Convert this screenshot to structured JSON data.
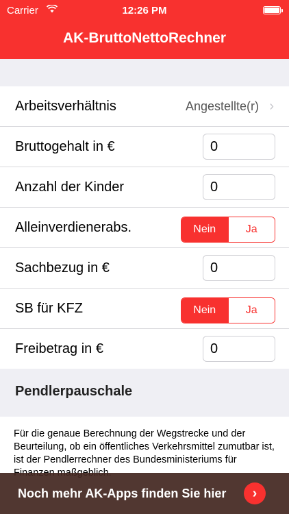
{
  "status_bar": {
    "carrier": "Carrier",
    "wifi_icon": "wifi-icon",
    "time": "12:26 PM",
    "battery_icon": "battery-icon"
  },
  "nav": {
    "title": "AK-BruttoNettoRechner"
  },
  "form": {
    "arbeitsverhaeltnis": {
      "label": "Arbeitsverhältnis",
      "value": "Angestellte(r)",
      "chevron": "›"
    },
    "bruttogehalt": {
      "label": "Bruttogehalt in €",
      "value": "0"
    },
    "kinder": {
      "label": "Anzahl der Kinder",
      "value": "0"
    },
    "alleinverdiener": {
      "label": "Alleinverdienerabs.",
      "options": [
        "Nein",
        "Ja"
      ],
      "selected": "Nein"
    },
    "sachbezug": {
      "label": "Sachbezug in €",
      "value": "0"
    },
    "sb_kfz": {
      "label": "SB für KFZ",
      "options": [
        "Nein",
        "Ja"
      ],
      "selected": "Nein"
    },
    "freibetrag": {
      "label": "Freibetrag in €",
      "value": "0"
    }
  },
  "pendler": {
    "title": "Pendlerpauschale",
    "text": "Für die genaue Berechnung der Wegstrecke und der Beurteilung, ob ein öffentliches Verkehrsmittel zumutbar ist, ist der Pendlerrechner des Bundesministeriums für Finanzen maßgeblich."
  },
  "banner": {
    "text": "Noch mehr AK-Apps finden Sie hier",
    "button_icon": "chevron-right-icon",
    "button_glyph": "›"
  },
  "colors": {
    "accent": "#f8312f",
    "banner": "#42261f"
  }
}
